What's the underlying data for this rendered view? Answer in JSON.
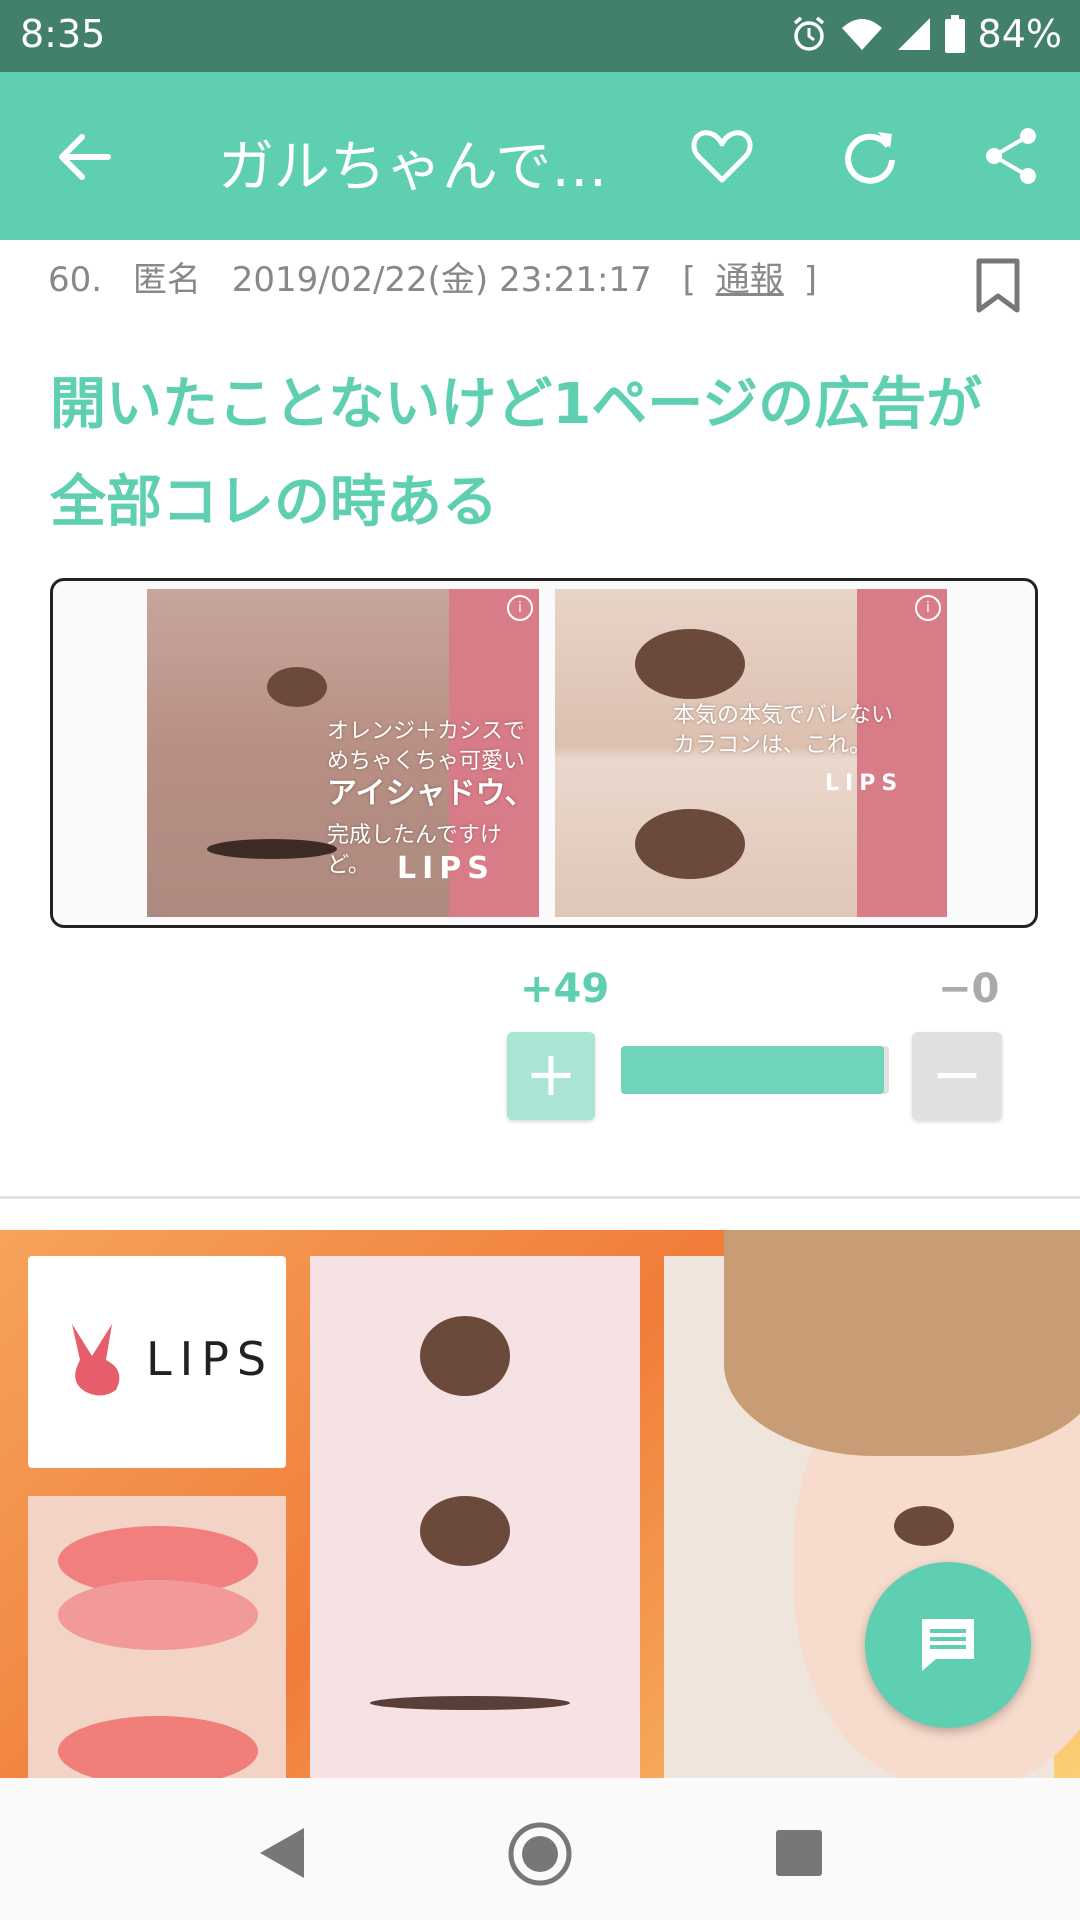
{
  "status_bar": {
    "time": "8:35",
    "battery": "84%",
    "icons": [
      "alarm-icon",
      "wifi-icon",
      "signal-icon",
      "battery-icon"
    ]
  },
  "app_bar": {
    "title": "ガルちゃんで…",
    "icons": [
      "back-arrow-icon",
      "heart-icon",
      "refresh-icon",
      "share-icon"
    ],
    "background_color": "#5ecfb1"
  },
  "comment": {
    "number": "60.",
    "author": "匿名",
    "datetime": "2019/02/22(金) 23:21:17",
    "report_open": "[",
    "report_label": "通報",
    "report_close": "]",
    "body": "開いたことないけど1ページの広告が全部コレの時ある",
    "image": {
      "left_panel": {
        "caption": "オレンジ＋カシスで\nめちゃくちゃ可愛い",
        "headline": "アイシャドウ、",
        "subline": "完成したんですけど。",
        "logo": "LIPS"
      },
      "right_panel": {
        "caption": "本気の本気でバレない\nカラコンは、これ。",
        "logo": "LIPS"
      }
    },
    "votes": {
      "plus_count": "+49",
      "minus_count": "−0",
      "plus_label": "+",
      "minus_label": "−",
      "positive_share": 0.98
    }
  },
  "banner_ad": {
    "logo_text": "LIPS",
    "info_symbol": "i"
  },
  "fab": {
    "icon": "comment-icon"
  },
  "nav_bar": {
    "icons": [
      "nav-back-icon",
      "nav-home-icon",
      "nav-recent-icon"
    ]
  }
}
